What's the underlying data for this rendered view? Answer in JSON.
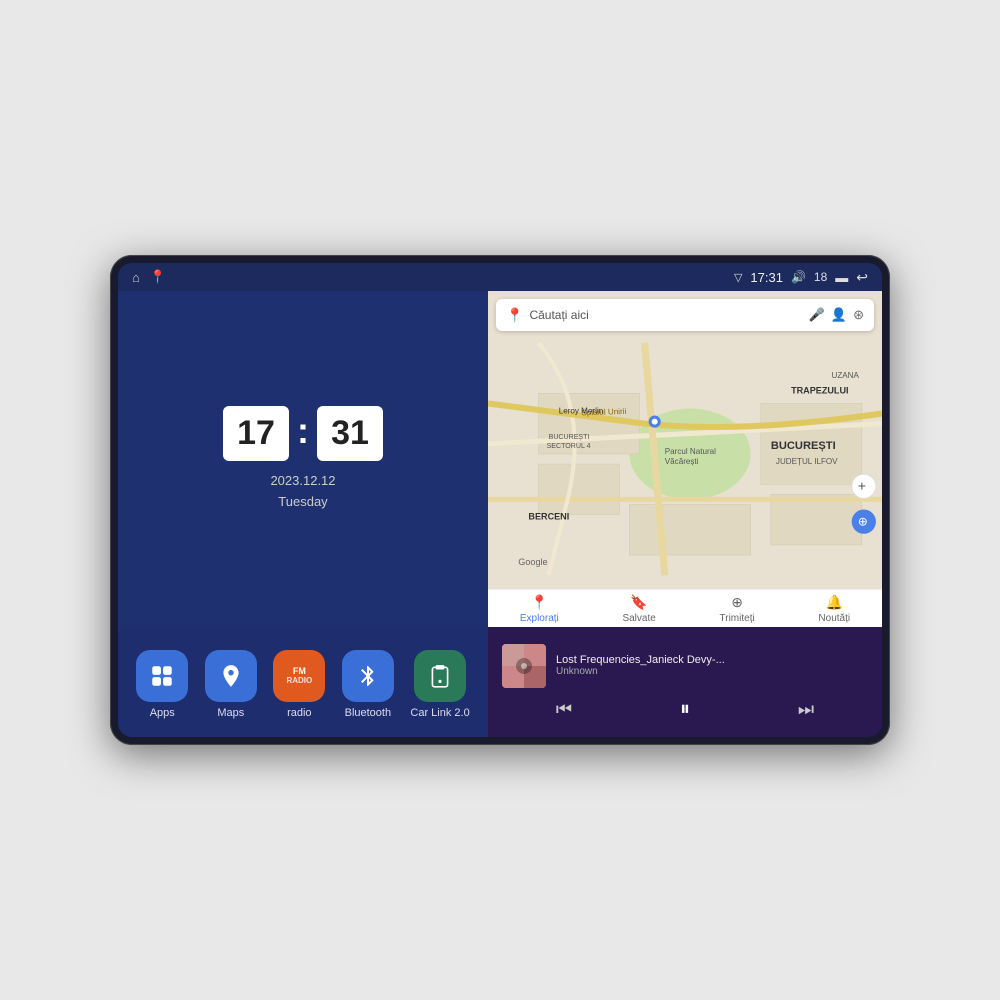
{
  "device": {
    "screen_bg": "#1c2a5e"
  },
  "status_bar": {
    "left_icons": [
      "home-icon",
      "maps-pin-icon"
    ],
    "signal_icon": "▽",
    "time": "17:31",
    "volume_icon": "🔊",
    "battery_level": "18",
    "battery_icon": "battery-icon",
    "back_icon": "↩"
  },
  "clock": {
    "hour": "17",
    "minute": "31",
    "date": "2023.12.12",
    "day": "Tuesday"
  },
  "apps": [
    {
      "id": "apps",
      "label": "Apps",
      "icon": "⊞",
      "color_class": "icon-apps"
    },
    {
      "id": "maps",
      "label": "Maps",
      "icon": "📍",
      "color_class": "icon-maps"
    },
    {
      "id": "radio",
      "label": "radio",
      "icon": "FM",
      "color_class": "icon-radio"
    },
    {
      "id": "bluetooth",
      "label": "Bluetooth",
      "icon": "⬡",
      "color_class": "icon-bluetooth"
    },
    {
      "id": "carlink",
      "label": "Car Link 2.0",
      "icon": "📱",
      "color_class": "icon-carlink"
    }
  ],
  "map": {
    "search_placeholder": "Căutați aici",
    "nav_items": [
      {
        "id": "explorați",
        "label": "Explorați",
        "icon": "📍",
        "active": true
      },
      {
        "id": "salvate",
        "label": "Salvate",
        "icon": "🔖",
        "active": false
      },
      {
        "id": "trimiteți",
        "label": "Trimiteți",
        "icon": "⊕",
        "active": false
      },
      {
        "id": "noutăți",
        "label": "Noutăți",
        "icon": "🔔",
        "active": false
      }
    ],
    "location_labels": [
      "Parcul Natural Văcărești",
      "BUCUREȘTI",
      "JUDEȚUL ILFOV",
      "BERCENI",
      "Leroy Merlin",
      "BUCUREȘTI SECTORUL 4",
      "TRAPEZULUI",
      "UZANA",
      "Splaiul Unirii",
      "Google"
    ]
  },
  "music": {
    "title": "Lost Frequencies_Janieck Devy-...",
    "artist": "Unknown",
    "controls": {
      "prev": "⏮",
      "play": "⏸",
      "next": "⏭"
    }
  }
}
